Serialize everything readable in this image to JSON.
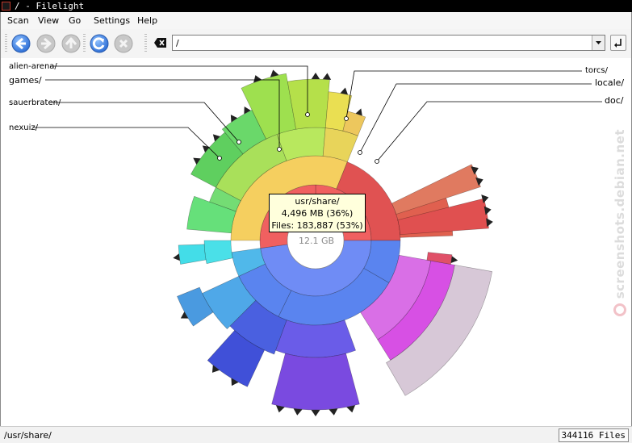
{
  "window": {
    "title": "/ - Filelight"
  },
  "menu": [
    "Scan",
    "View",
    "Go",
    "Settings",
    "Help"
  ],
  "toolbar": {
    "back": "back-icon",
    "forward": "forward-icon",
    "up": "up-icon",
    "rescan": "rescan-icon",
    "stop": "stop-icon",
    "clear": "clear-location-icon"
  },
  "location": {
    "value": "/"
  },
  "chart": {
    "center_label": "12.1 GB",
    "tooltip": {
      "name": "usr/share/",
      "size": "4,496 MB (36%)",
      "files": "Files: 183,887 (53%)"
    },
    "labels": {
      "alien_arena": "alien-arena/",
      "games": "games/",
      "sauerbraten": "sauerbraten/",
      "nexuiz": "nexuiz/",
      "torcs": "torcs/",
      "locale": "locale/",
      "doc": "doc/"
    }
  },
  "status": {
    "path": "/usr/share/",
    "files": "344116 Files"
  },
  "watermark": "screenshots.debian.net"
}
